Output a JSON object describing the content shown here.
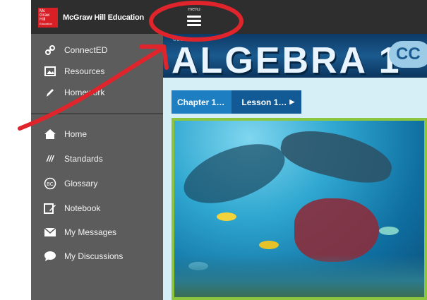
{
  "header": {
    "logo_lines": [
      "Mc",
      "Graw",
      "Hill",
      "Education"
    ],
    "brand": "McGraw Hill Education",
    "menu_label": "menu"
  },
  "sidebar": {
    "items": [
      {
        "label": "ConnectED",
        "icon": "link-icon"
      },
      {
        "label": "Resources",
        "icon": "image-icon"
      },
      {
        "label": "Homework",
        "icon": "pencil-icon"
      },
      {
        "label": "Home",
        "icon": "home-icon"
      },
      {
        "label": "Standards",
        "icon": "standards-icon"
      },
      {
        "label": "Glossary",
        "icon": "glossary-icon"
      },
      {
        "label": "Notebook",
        "icon": "notebook-icon"
      },
      {
        "label": "My Messages",
        "icon": "envelope-icon"
      },
      {
        "label": "My Discussions",
        "icon": "speech-bubble-icon"
      }
    ]
  },
  "main": {
    "title_small": "GLENCOE",
    "title": "ALGEBRA 1",
    "badge": "CC",
    "breadcrumb": [
      {
        "label": "Chapter 1…"
      },
      {
        "label": "Lesson 1…"
      }
    ]
  },
  "colors": {
    "topbar": "#2e2e2e",
    "sidebar": "#5c5c5c",
    "brand_red": "#d81f26",
    "annotation_red": "#e0242b",
    "crumb_light": "#1d7fc2",
    "crumb_dark": "#115a96",
    "frame_green": "#8cc63f"
  }
}
